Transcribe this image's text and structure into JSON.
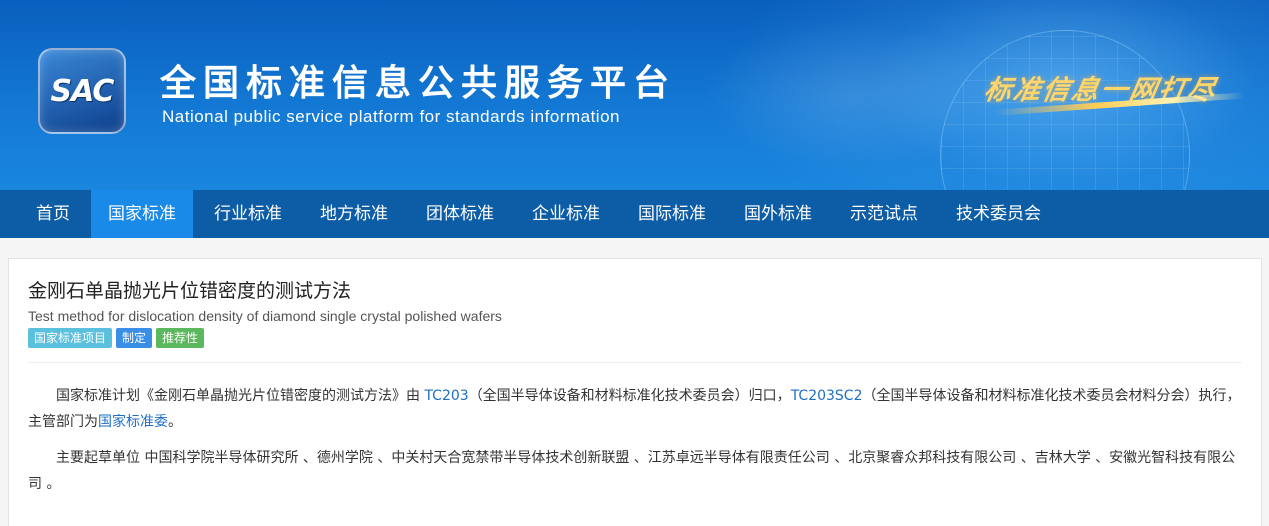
{
  "header": {
    "logo_text": "SAC",
    "title": "全国标准信息公共服务平台",
    "subtitle": "National public service platform  for standards information",
    "slogan": "标准信息一网打尽"
  },
  "nav": {
    "items": [
      {
        "label": "首页",
        "active": false
      },
      {
        "label": "国家标准",
        "active": true
      },
      {
        "label": "行业标准",
        "active": false
      },
      {
        "label": "地方标准",
        "active": false
      },
      {
        "label": "团体标准",
        "active": false
      },
      {
        "label": "企业标准",
        "active": false
      },
      {
        "label": "国际标准",
        "active": false
      },
      {
        "label": "国外标准",
        "active": false
      },
      {
        "label": "示范试点",
        "active": false
      },
      {
        "label": "技术委员会",
        "active": false
      }
    ]
  },
  "standard": {
    "title_cn": "金刚石单晶抛光片位错密度的测试方法",
    "title_en": "Test method for dislocation density of diamond single crystal polished wafers",
    "badges": [
      {
        "label": "国家标准项目",
        "color": "#5bc0de"
      },
      {
        "label": "制定",
        "color": "#3a8ee6"
      },
      {
        "label": "推荐性",
        "color": "#5cb85c"
      }
    ],
    "para1": {
      "prefix": "国家标准计划《金刚石单晶抛光片位错密度的测试方法》由 ",
      "tc1": "TC203",
      "mid1": "（全国半导体设备和材料标准化技术委员会）归口，",
      "tc2": "TC203SC2",
      "mid2": "（全国半导体设备和材料标准化技术委员会材料分会）执行，主管部门为",
      "dept": "国家标准委",
      "end": "。"
    },
    "para2": "主要起草单位 中国科学院半导体研究所 、德州学院 、中关村天合宽禁带半导体技术创新联盟 、江苏卓远半导体有限责任公司 、北京聚睿众邦科技有限公司 、吉林大学 、安徽光智科技有限公司 。"
  }
}
